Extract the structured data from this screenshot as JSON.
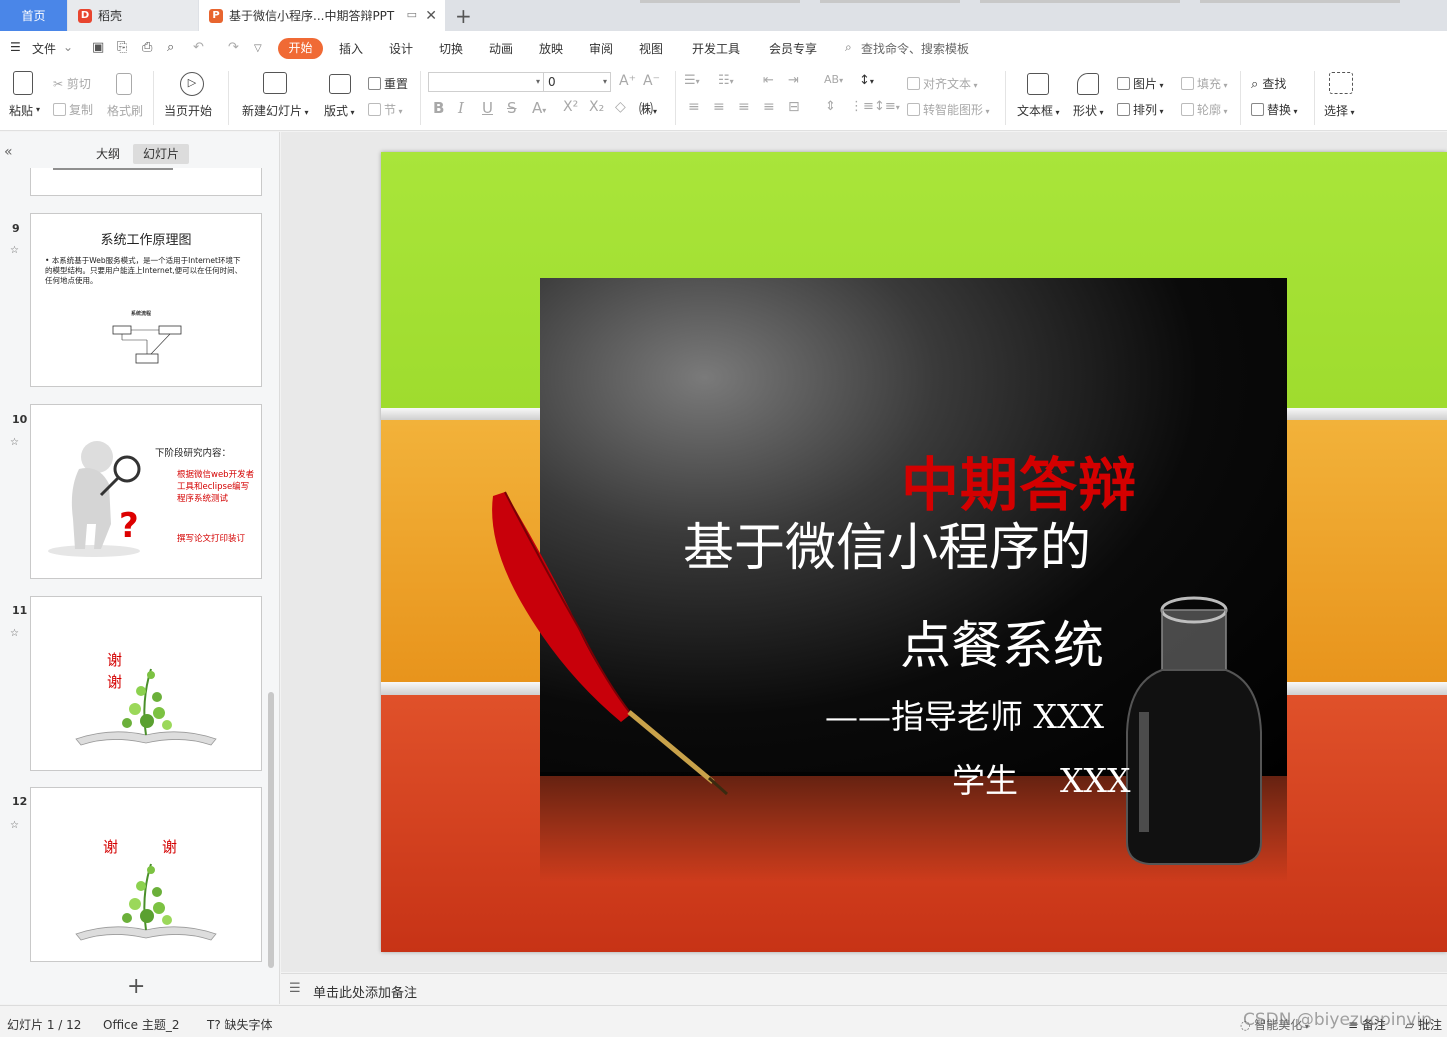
{
  "tabs": {
    "home": "首页",
    "doc": "稻壳",
    "ppt": "基于微信小程序...中期答辩PPT"
  },
  "menu": {
    "file": "文件",
    "items": [
      "开始",
      "插入",
      "设计",
      "切换",
      "动画",
      "放映",
      "审阅",
      "视图",
      "开发工具",
      "会员专享"
    ],
    "search": "查找命令、搜索模板"
  },
  "ribbon": {
    "paste": "粘贴",
    "cut": "剪切",
    "copy": "复制",
    "format_painter": "格式刷",
    "play_from_current": "当页开始",
    "new_slide": "新建幻灯片",
    "layout": "版式",
    "reset": "重置",
    "section": "节",
    "font_size": "0",
    "align_text": "对齐文本",
    "smartart": "转智能图形",
    "textbox": "文本框",
    "shape": "形状",
    "picture": "图片",
    "arrange": "排列",
    "fill": "填充",
    "outline": "轮廓",
    "find": "查找",
    "replace": "替换",
    "select": "选择"
  },
  "left_panel": {
    "tab_outline": "大纲",
    "tab_slides": "幻灯片",
    "slides": [
      {
        "num": "9",
        "title": "系统工作原理图",
        "body": "本系统基于Web服务模式，是一个适用于Internet环境下的模型结构。只要用户能连上Internet,便可以在任何时间、任何地点使用。",
        "diagram_title": "系统流程"
      },
      {
        "num": "10",
        "title": "下阶段研究内容：",
        "lines": [
          "根据微信web开发者工具和eclipse编写程序系统测试",
          "撰写论文打印装订"
        ]
      },
      {
        "num": "11",
        "text": "谢谢"
      },
      {
        "num": "12",
        "text1": "谢",
        "text2": "谢"
      }
    ]
  },
  "slide": {
    "title_red": "中期答辩",
    "line1": "基于微信小程序的",
    "line2": "点餐系统",
    "advisor": "——指导老师  XXX",
    "student": "学生    XXX"
  },
  "notes": "单击此处添加备注",
  "status": {
    "slide_count": "幻灯片 1 / 12",
    "theme": "Office 主题_2",
    "missing_font": "缺失字体",
    "beautify": "智能美化",
    "notes": "备注",
    "comment": "批注",
    "watermark": "CSDN @biyezuopinvip"
  },
  "colors": {
    "accent": "#f06a35",
    "home_tab": "#4a86e8",
    "slide_green": "#a6e234",
    "slide_orange": "#ef9a22",
    "slide_red": "#d8421f",
    "title_red": "#d40000"
  }
}
